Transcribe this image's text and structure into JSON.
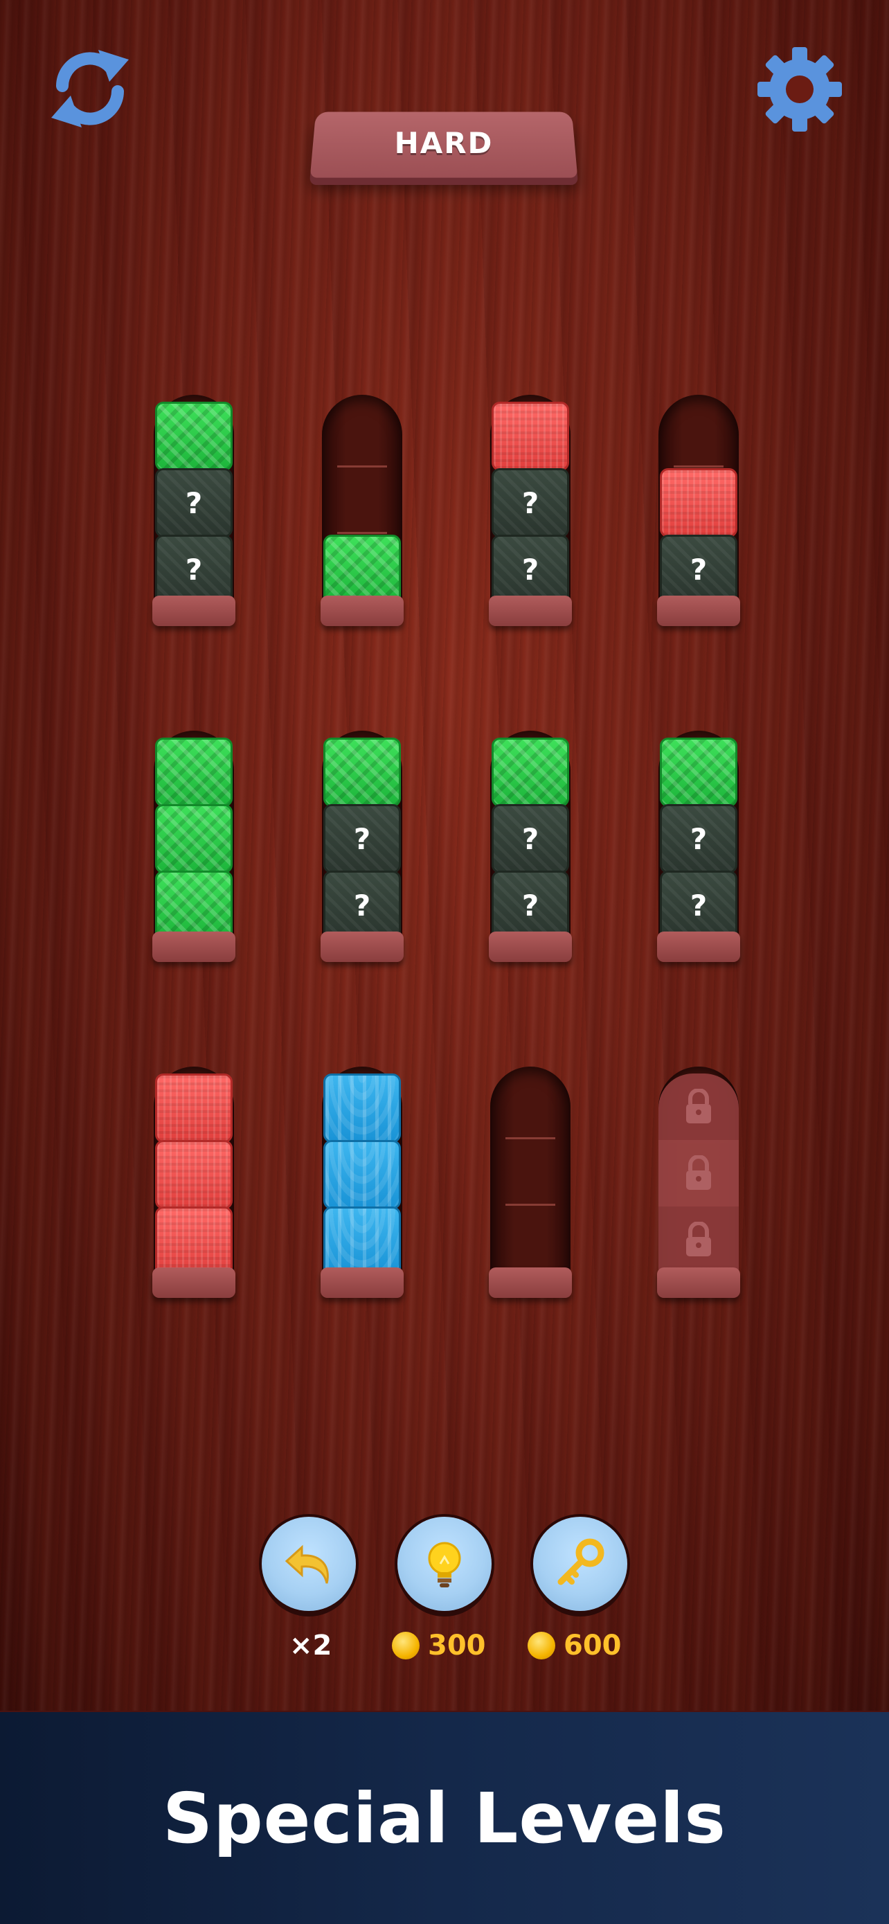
{
  "header": {
    "difficulty_label": "HARD",
    "restart_icon": "refresh-icon",
    "settings_icon": "gear-icon"
  },
  "colors": {
    "green": "#2fcb4a",
    "red": "#f0514f",
    "blue": "#2aa6e6",
    "hidden": "#333f37",
    "icon_blue": "#5a93dd",
    "coin_text": "#ffc12b"
  },
  "board": {
    "rows": [
      [
        {
          "state": "open",
          "blocks": [
            "green",
            "hidden",
            "hidden"
          ]
        },
        {
          "state": "open",
          "blocks": [
            "green"
          ]
        },
        {
          "state": "open",
          "blocks": [
            "red",
            "hidden",
            "hidden"
          ]
        },
        {
          "state": "open",
          "blocks": [
            "red",
            "hidden"
          ]
        }
      ],
      [
        {
          "state": "open",
          "blocks": [
            "green",
            "green",
            "green"
          ]
        },
        {
          "state": "open",
          "blocks": [
            "green",
            "hidden",
            "hidden"
          ]
        },
        {
          "state": "open",
          "blocks": [
            "green",
            "hidden",
            "hidden"
          ]
        },
        {
          "state": "open",
          "blocks": [
            "green",
            "hidden",
            "hidden"
          ]
        }
      ],
      [
        {
          "state": "open",
          "blocks": [
            "red",
            "red",
            "red"
          ]
        },
        {
          "state": "open",
          "blocks": [
            "blue",
            "blue",
            "blue"
          ]
        },
        {
          "state": "open",
          "blocks": []
        },
        {
          "state": "locked",
          "blocks": []
        }
      ]
    ],
    "hidden_mark": "?"
  },
  "tools": {
    "undo": {
      "icon": "undo-arrow-icon",
      "count_label": "×2"
    },
    "hint": {
      "icon": "lightbulb-icon",
      "cost": "300"
    },
    "unlock": {
      "icon": "key-icon",
      "cost": "600"
    }
  },
  "footer": {
    "promo_text": "Special Levels"
  }
}
